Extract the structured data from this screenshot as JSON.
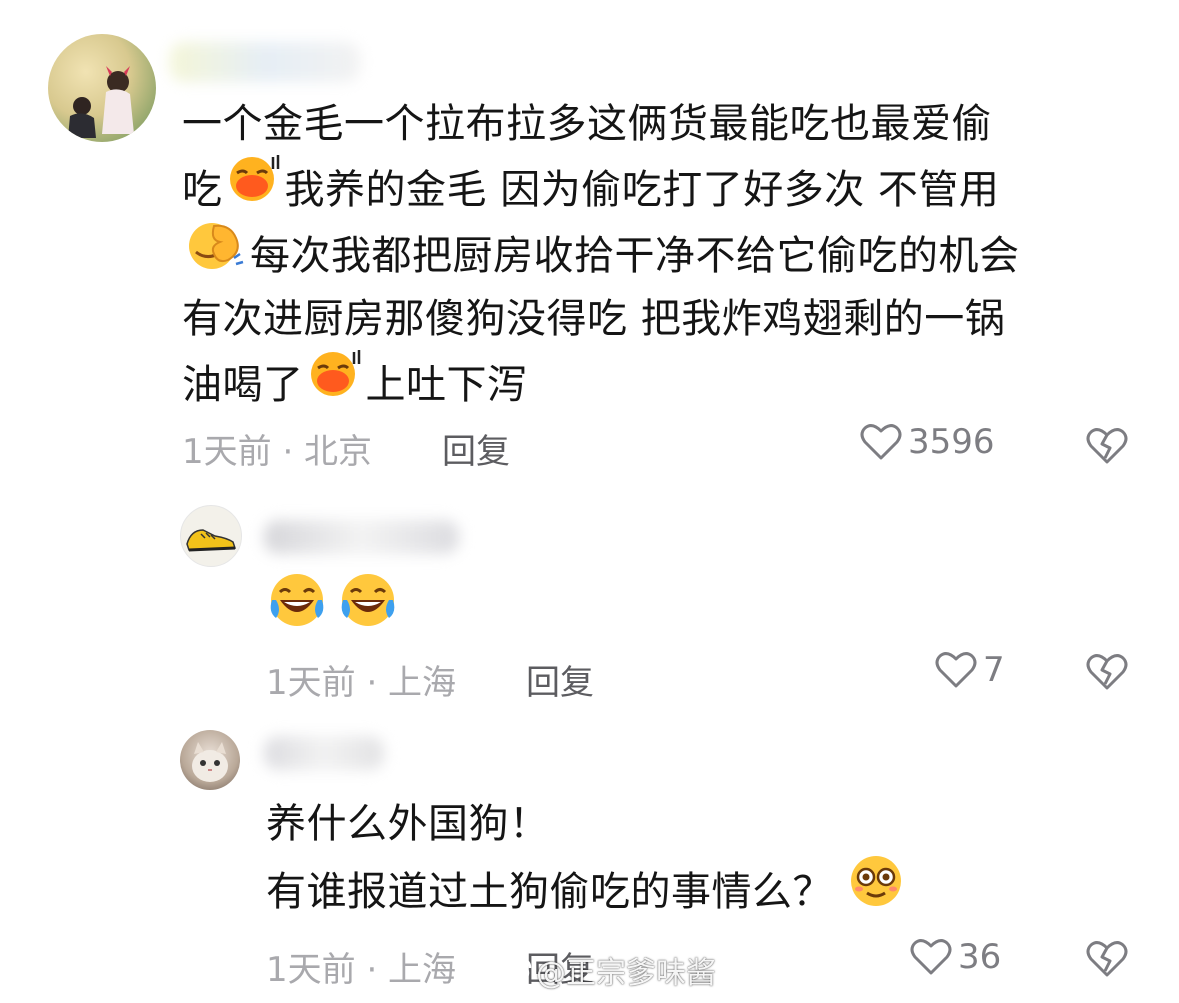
{
  "comments": [
    {
      "lines": [
        "一个金毛一个拉布拉多这俩货最能吃也最爱偷",
        "吃{emoji}我养的金毛 因为偷吃打了好多次 不管用",
        "{emoji}每次我都把厨房收拾干净不给它偷吃的机会",
        "有次进厨房那傻狗没得吃 把我炸鸡翅剩的一锅",
        "油喝了{emoji}上吐下泻"
      ],
      "line_1": "一个金毛一个拉布拉多这俩货最能吃也最爱偷",
      "line_2a": "吃",
      "line_2b": "我养的金毛 因为偷吃打了好多次 不管用",
      "line_3": "每次我都把厨房收拾干净不给它偷吃的机会",
      "line_4": "有次进厨房那傻狗没得吃 把我炸鸡翅剩的一锅",
      "line_5a": "油喝了",
      "line_5b": "上吐下泻",
      "meta": "1天前 · 北京",
      "reply_label": "回复",
      "likes": "3596",
      "emoji_names": [
        "pouting-lips-emoji",
        "facepalm-emoji",
        "pouting-lips-emoji"
      ]
    },
    {
      "meta": "1天前 · 上海",
      "reply_label": "回复",
      "likes": "7",
      "emoji_names": [
        "laughing-crying-emoji",
        "laughing-crying-emoji"
      ]
    },
    {
      "line_1": "养什么外国狗！",
      "line_2": "有谁报道过土狗偷吃的事情么？",
      "meta": "1天前 · 上海",
      "reply_label": "回复",
      "likes": "36",
      "emoji_names": [
        "dizzy-eyes-emoji"
      ]
    }
  ],
  "watermark": "@正宗爹味酱",
  "colors": {
    "meta_text": "#a9a9ad",
    "reply_text": "#5c5c60",
    "like_text": "#7d7d82",
    "emoji_yellow": "#ffc83d",
    "emoji_orange": "#ff6a1a"
  }
}
